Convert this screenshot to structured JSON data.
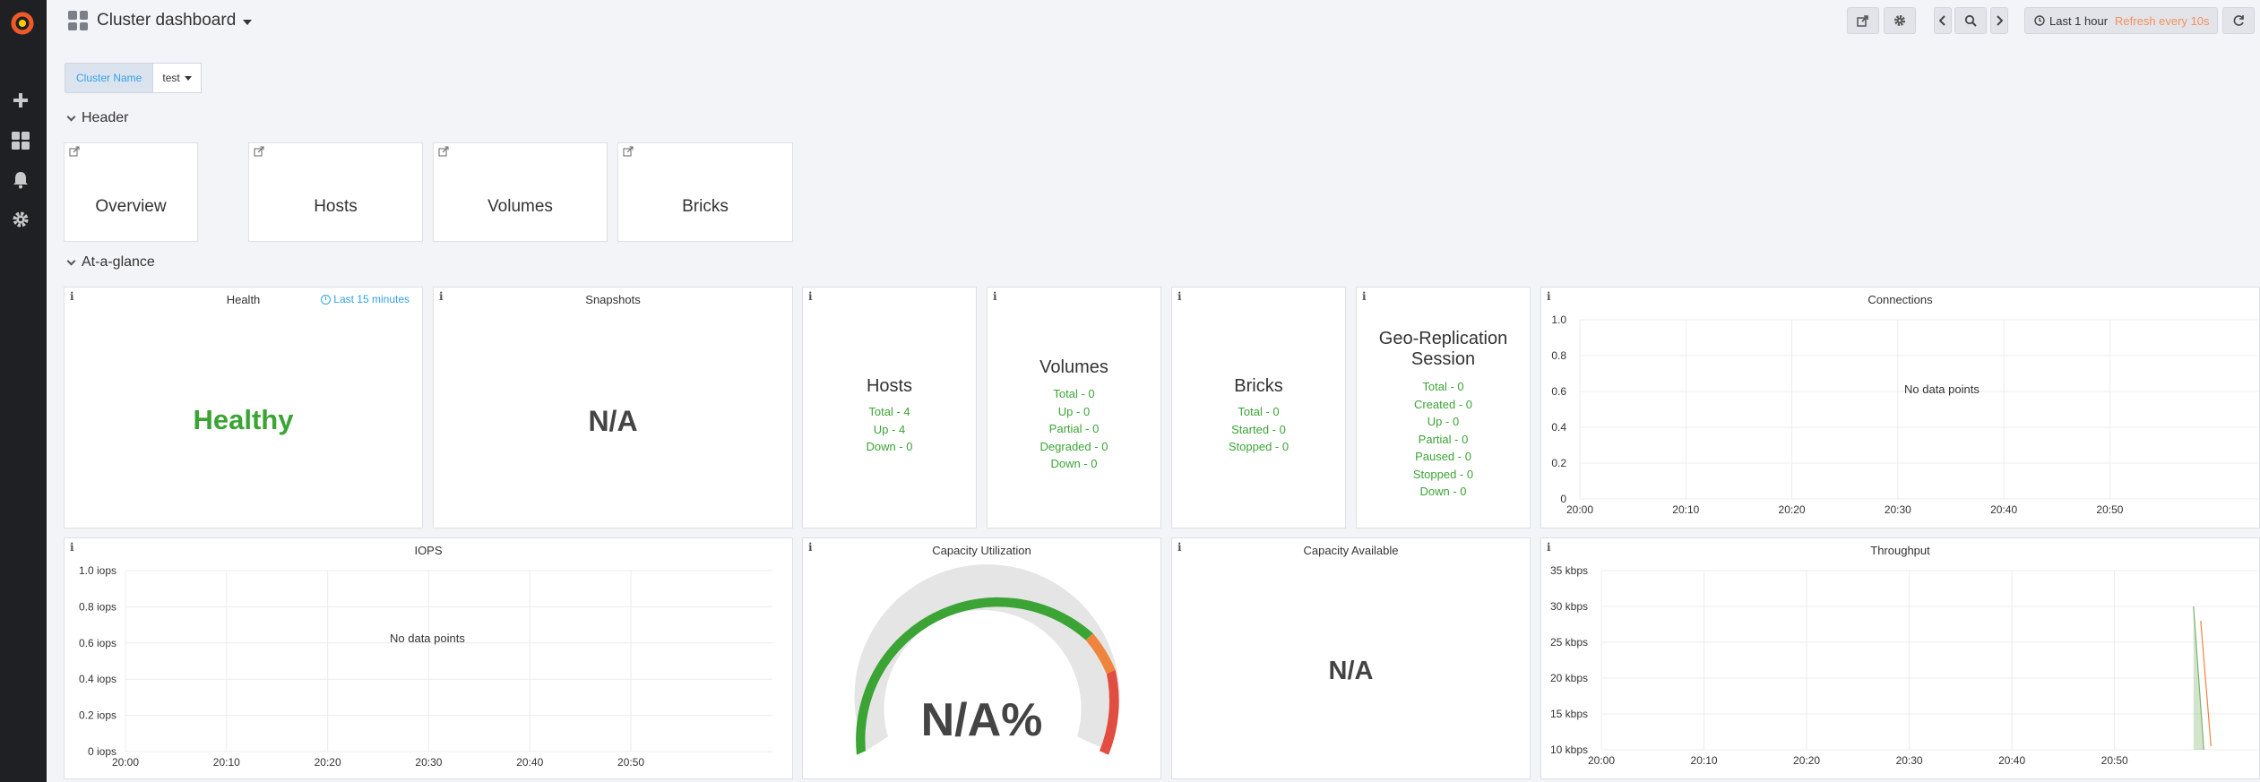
{
  "app": {
    "dashboard_title": "Cluster dashboard"
  },
  "topbar": {
    "time_range": "Last 1 hour",
    "refresh": "Refresh every 10s"
  },
  "template_vars": {
    "cluster_label": "Cluster Name",
    "cluster_value": "test"
  },
  "rows": {
    "header": "Header",
    "glance": "At-a-glance"
  },
  "header_links": [
    "Overview",
    "Hosts",
    "Volumes",
    "Bricks"
  ],
  "panels": {
    "health": {
      "title": "Health",
      "time_override": "Last 15 minutes",
      "value": "Healthy"
    },
    "snapshots": {
      "title": "Snapshots",
      "value": "N/A"
    },
    "hosts": {
      "title": "Hosts",
      "lines": [
        "Total - 4",
        "Up - 4",
        "Down - 0"
      ]
    },
    "volumes": {
      "title": "Volumes",
      "lines": [
        "Total - 0",
        "Up - 0",
        "Partial - 0",
        "Degraded - 0",
        "Down - 0"
      ]
    },
    "bricks": {
      "title": "Bricks",
      "lines": [
        "Total - 0",
        "Started - 0",
        "Stopped - 0"
      ]
    },
    "georep": {
      "title_line1": "Geo-Replication",
      "title_line2": "Session",
      "lines": [
        "Total - 0",
        "Created - 0",
        "Up - 0",
        "Partial - 0",
        "Paused - 0",
        "Stopped - 0",
        "Down - 0"
      ]
    },
    "connections": {
      "title": "Connections",
      "no_data": "No data points"
    },
    "iops": {
      "title": "IOPS",
      "no_data": "No data points"
    },
    "capacity_util": {
      "title": "Capacity Utilization",
      "value": "N/A%"
    },
    "capacity_avail": {
      "title": "Capacity Available",
      "value": "N/A"
    },
    "throughput": {
      "title": "Throughput"
    }
  },
  "colors": {
    "healthy": "#3ba435",
    "accent": "#33a2e5",
    "refresh": "#f4915b",
    "gauge_green": "#3ba435",
    "gauge_orange": "#ef843c",
    "gauge_red": "#e24d42"
  },
  "chart_data": [
    {
      "name_of_panel": "Connections",
      "type": "line",
      "title": "Connections",
      "x": [
        "20:00",
        "20:10",
        "20:20",
        "20:30",
        "20:40",
        "20:50"
      ],
      "y_ticks": [
        "1.0",
        "0.8",
        "0.6",
        "0.4",
        "0.2",
        "0"
      ],
      "ylim": [
        0,
        1.0
      ],
      "series": [],
      "annotation": "No data points"
    },
    {
      "name_of_panel": "IOPS",
      "type": "line",
      "title": "IOPS",
      "x": [
        "20:00",
        "20:10",
        "20:20",
        "20:30",
        "20:40",
        "20:50"
      ],
      "y_ticks": [
        "1.0 iops",
        "0.8 iops",
        "0.6 iops",
        "0.4 iops",
        "0.2 iops",
        "0 iops"
      ],
      "ylim": [
        0,
        1.0
      ],
      "series": [],
      "annotation": "No data points"
    },
    {
      "name_of_panel": "Throughput",
      "type": "area",
      "title": "Throughput",
      "x": [
        "20:00",
        "20:10",
        "20:20",
        "20:30",
        "20:40",
        "20:50"
      ],
      "y_ticks": [
        "35 kbps",
        "30 kbps",
        "25 kbps",
        "20 kbps",
        "15 kbps",
        "10 kbps"
      ],
      "ylim": [
        10,
        35
      ],
      "series": [
        {
          "color": "#7eb26d",
          "points": [
            [
              57.7,
              30
            ],
            [
              58.7,
              10
            ]
          ]
        },
        {
          "color": "#ef843c",
          "points": [
            [
              58.4,
              28
            ],
            [
              59.4,
              10.5
            ]
          ]
        }
      ]
    }
  ]
}
